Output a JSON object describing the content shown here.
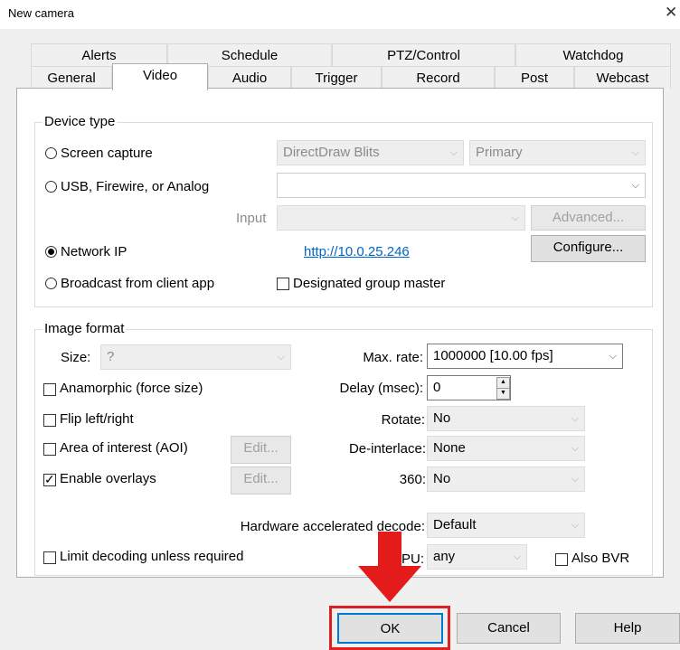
{
  "window": {
    "title": "New camera",
    "close_glyph": "✕"
  },
  "tabs_row1": [
    "Alerts",
    "Schedule",
    "PTZ/Control",
    "Watchdog"
  ],
  "tabs_row2": [
    "General",
    "Video",
    "Audio",
    "Trigger",
    "Record",
    "Post",
    "Webcast"
  ],
  "active_tab": "Video",
  "device_type": {
    "legend": "Device type",
    "screen_capture": "Screen capture",
    "usb": "USB, Firewire, or Analog",
    "network_ip": "Network IP",
    "broadcast": "Broadcast from client app",
    "selected": "network_ip",
    "capture_method": "DirectDraw Blits",
    "capture_display": "Primary",
    "input_label": "Input",
    "advanced_btn": "Advanced...",
    "configure_btn": "Configure...",
    "ip_link": "http://10.0.25.246",
    "group_master_label": "Designated group master",
    "group_master_checked": false
  },
  "image_format": {
    "legend": "Image format",
    "size_label": "Size:",
    "size_value": "?",
    "anamorphic_label": "Anamorphic (force size)",
    "anamorphic_checked": false,
    "flip_label": "Flip left/right",
    "flip_checked": false,
    "aoi_label": "Area of interest (AOI)",
    "aoi_checked": false,
    "overlays_label": "Enable overlays",
    "overlays_checked": true,
    "edit_btn": "Edit...",
    "max_rate_label": "Max. rate:",
    "max_rate_value": "1000000 [10.00 fps]",
    "delay_label": "Delay (msec):",
    "delay_value": "0",
    "rotate_label": "Rotate:",
    "rotate_value": "No",
    "deinterlace_label": "De-interlace:",
    "deinterlace_value": "None",
    "label_360": "360:",
    "value_360": "No",
    "hw_label": "Hardware accelerated decode:",
    "hw_value": "Default",
    "gpu_label_visible": "PU:",
    "gpu_value": "any",
    "limit_label": "Limit decoding unless required",
    "limit_checked": false,
    "bvr_label": "Also BVR",
    "bvr_checked": false
  },
  "footer": {
    "ok": "OK",
    "cancel": "Cancel",
    "help": "Help"
  },
  "colors": {
    "highlight": "#e02020",
    "link": "#0066cc"
  }
}
